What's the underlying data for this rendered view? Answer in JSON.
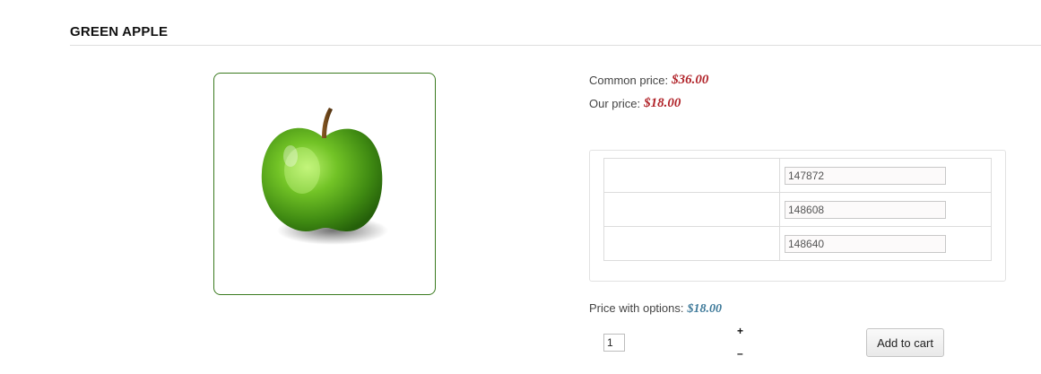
{
  "product": {
    "title": "GREEN APPLE",
    "image_icon": "green-apple-image"
  },
  "prices": {
    "common_label": "Common price:",
    "common_value": "$36.00",
    "our_label": "Our price:",
    "our_value": "$18.00",
    "common_color": "#b1242a",
    "our_color": "#b1242a"
  },
  "options": {
    "rows": [
      {
        "label": "",
        "value": "147872"
      },
      {
        "label": "",
        "value": "148608"
      },
      {
        "label": "",
        "value": "148640"
      }
    ]
  },
  "price_with_options": {
    "label": "Price with options:",
    "value": "$18.00",
    "color": "#3f7a9a"
  },
  "quantity": {
    "value": "1",
    "plus": "+",
    "minus": "–"
  },
  "cart": {
    "button_label": "Add to cart"
  }
}
